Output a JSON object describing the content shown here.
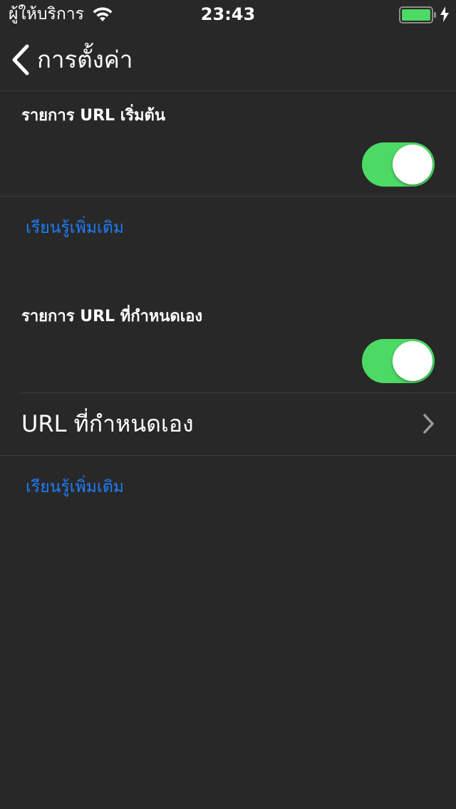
{
  "status_bar": {
    "carrier": "ผู้ให้บริการ",
    "time": "23:43",
    "wifi_icon": "wifi-icon",
    "battery_icon": "battery-full-icon",
    "charging_icon": "charging-bolt-icon",
    "battery_color": "#4cd964"
  },
  "nav": {
    "back_label": "การตั้งค่า",
    "back_icon": "chevron-left-icon"
  },
  "sections": [
    {
      "header": "รายการ URL เริ่มต้น",
      "toggle_on": true,
      "learn_more": "เรียนรู้เพิ่มเติม"
    },
    {
      "header": "รายการ URL ที่กำหนดเอง",
      "toggle_on": true,
      "row_label": "URL ที่กำหนดเอง",
      "row_icon": "chevron-right-icon",
      "learn_more": "เรียนรู้เพิ่มเติม"
    }
  ],
  "colors": {
    "background": "#282828",
    "accent_link": "#1e7cf5",
    "toggle_on": "#4cd964"
  }
}
